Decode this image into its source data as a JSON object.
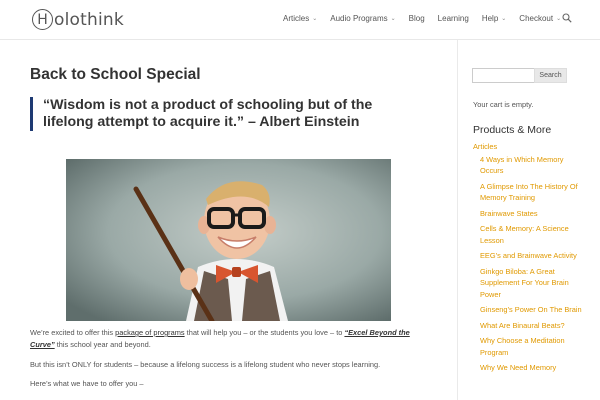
{
  "header": {
    "logo_letter": "H",
    "logo_rest": "olothink",
    "nav": [
      {
        "label": "Articles",
        "dropdown": true
      },
      {
        "label": "Audio Programs",
        "dropdown": true
      },
      {
        "label": "Blog",
        "dropdown": false
      },
      {
        "label": "Learning",
        "dropdown": false
      },
      {
        "label": "Help",
        "dropdown": true
      },
      {
        "label": "Checkout",
        "dropdown": true
      }
    ]
  },
  "main": {
    "title": "Back to School Special",
    "quote": "“Wisdom is not a product of schooling but of the lifelong attempt to acquire it.” – Albert Einstein",
    "para1": {
      "pre": "We’re excited to offer this ",
      "link1": "package of programs",
      "mid": " that will help you – or the students you love – to ",
      "link2": "“Excel Beyond the Curve”",
      "post": " this school year and beyond."
    },
    "para2": "But this isn’t ONLY for students – because a lifelong success is a lifelong student who never stops learning.",
    "para3": "Here’s what we have to offer you –"
  },
  "sidebar": {
    "search_button": "Search",
    "cart": "Your cart is empty.",
    "widget_title": "Products & More",
    "category": "Articles",
    "items": [
      "4 Ways in Which Memory Occurs",
      "A Glimpse Into The History Of Memory Training",
      "Brainwave States",
      "Cells & Memory: A Science Lesson",
      "EEG’s and Brainwave Activity",
      "Ginkgo Biloba: A Great Supplement For Your Brain Power",
      "Ginseng’s Power On The Brain",
      "What Are Binaural Beats?",
      "Why Choose a Meditation Program",
      "Why We Need Memory"
    ]
  },
  "colors": {
    "accent": "#e09900",
    "quote_bar": "#1e3a73"
  }
}
